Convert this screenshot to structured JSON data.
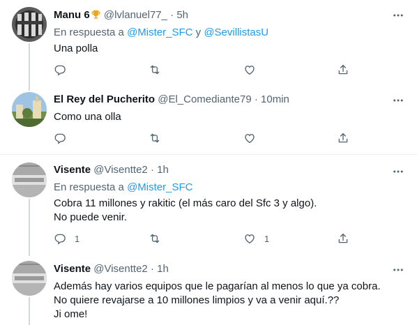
{
  "tweets": [
    {
      "name": "Manu 6",
      "handle": "@lvlanuel77_",
      "dot": "·",
      "time": "5h",
      "reply_prefix": "En respuesta a",
      "reply_mentions": [
        "@Mister_SFC",
        "@SevillistasU"
      ],
      "reply_joiner": "y",
      "lines": [
        "Una polla"
      ],
      "counts": {
        "reply": "",
        "retweet": "",
        "like": ""
      }
    },
    {
      "name": "El Rey del Pucherito",
      "handle": "@El_Comediante79",
      "dot": "·",
      "time": "10min",
      "lines": [
        "Como una olla"
      ],
      "counts": {
        "reply": "",
        "retweet": "",
        "like": ""
      }
    },
    {
      "name": "Visente",
      "handle": "@Visentte2",
      "dot": "·",
      "time": "1h",
      "reply_prefix": "En respuesta a",
      "reply_mentions": [
        "@Mister_SFC"
      ],
      "lines": [
        "Cobra 11 millones y rakitic (el más caro del Sfc 3 y algo).",
        "No puede venir."
      ],
      "counts": {
        "reply": "1",
        "retweet": "",
        "like": "1"
      }
    },
    {
      "name": "Visente",
      "handle": "@Visentte2",
      "dot": "·",
      "time": "1h",
      "lines": [
        "Además hay varios equipos que le pagarían  al menos lo que ya cobra.",
        "No quiere revajarse  a 10 millones limpios y va a venir aquí.??",
        "Ji ome!"
      ]
    }
  ],
  "icons": {
    "more": "more-icon",
    "reply": "reply-icon",
    "retweet": "retweet-icon",
    "like": "like-icon",
    "share": "share-icon",
    "trophy": "trophy-icon"
  },
  "colors": {
    "text": "#0f1419",
    "muted": "#536471",
    "link": "#1d9bf0",
    "divider": "#ebeef0",
    "thread_line": "#cfd9de"
  }
}
